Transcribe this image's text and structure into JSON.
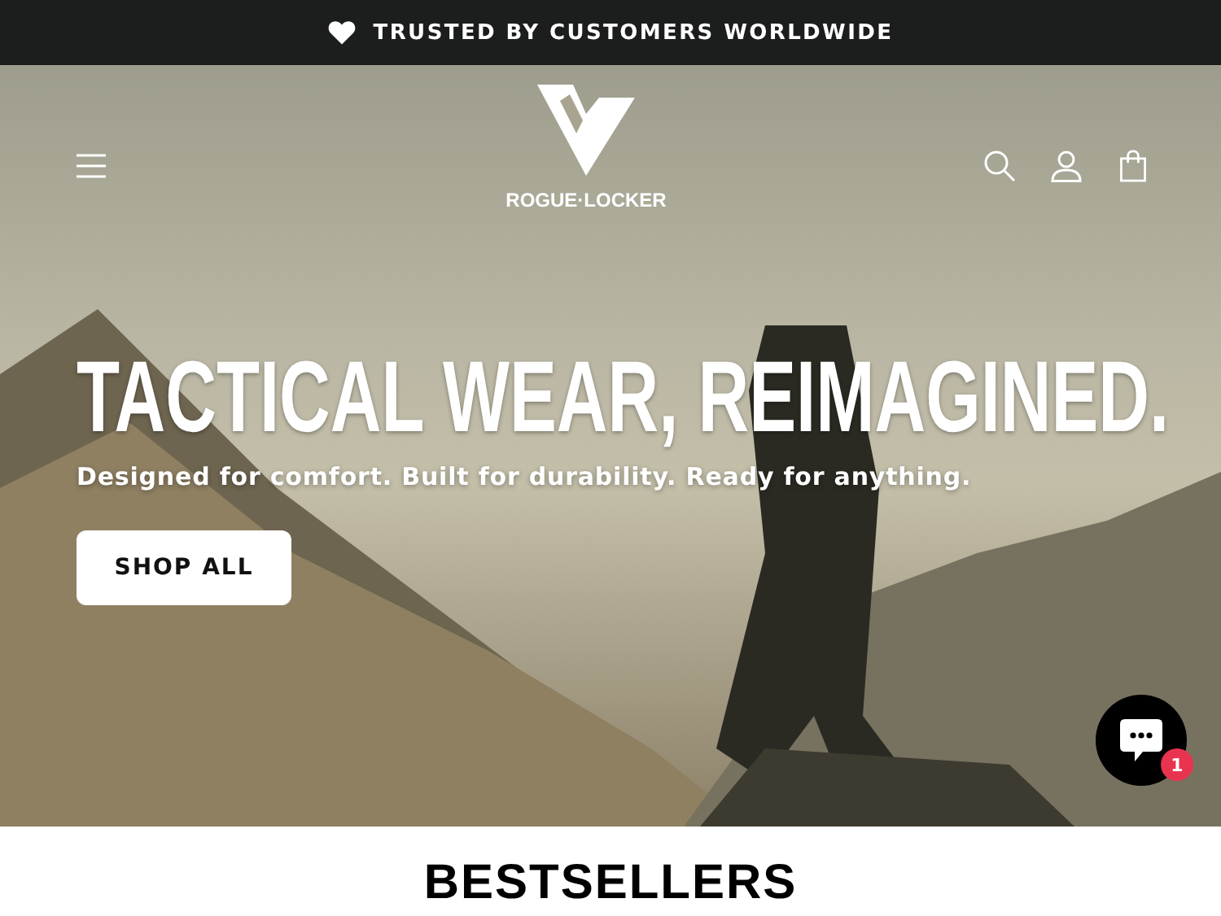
{
  "announcement": {
    "text": "TRUSTED BY CUSTOMERS WORLDWIDE"
  },
  "header": {
    "logo_text": "ROGUE·LOCKER"
  },
  "hero": {
    "heading": "TACTICAL WEAR, REIMAGINED.",
    "subheading": "Designed for comfort. Built for durability. Ready for anything.",
    "button": "SHOP ALL"
  },
  "chat": {
    "badge": "1"
  },
  "section": {
    "heading": "BESTSELLERS"
  }
}
